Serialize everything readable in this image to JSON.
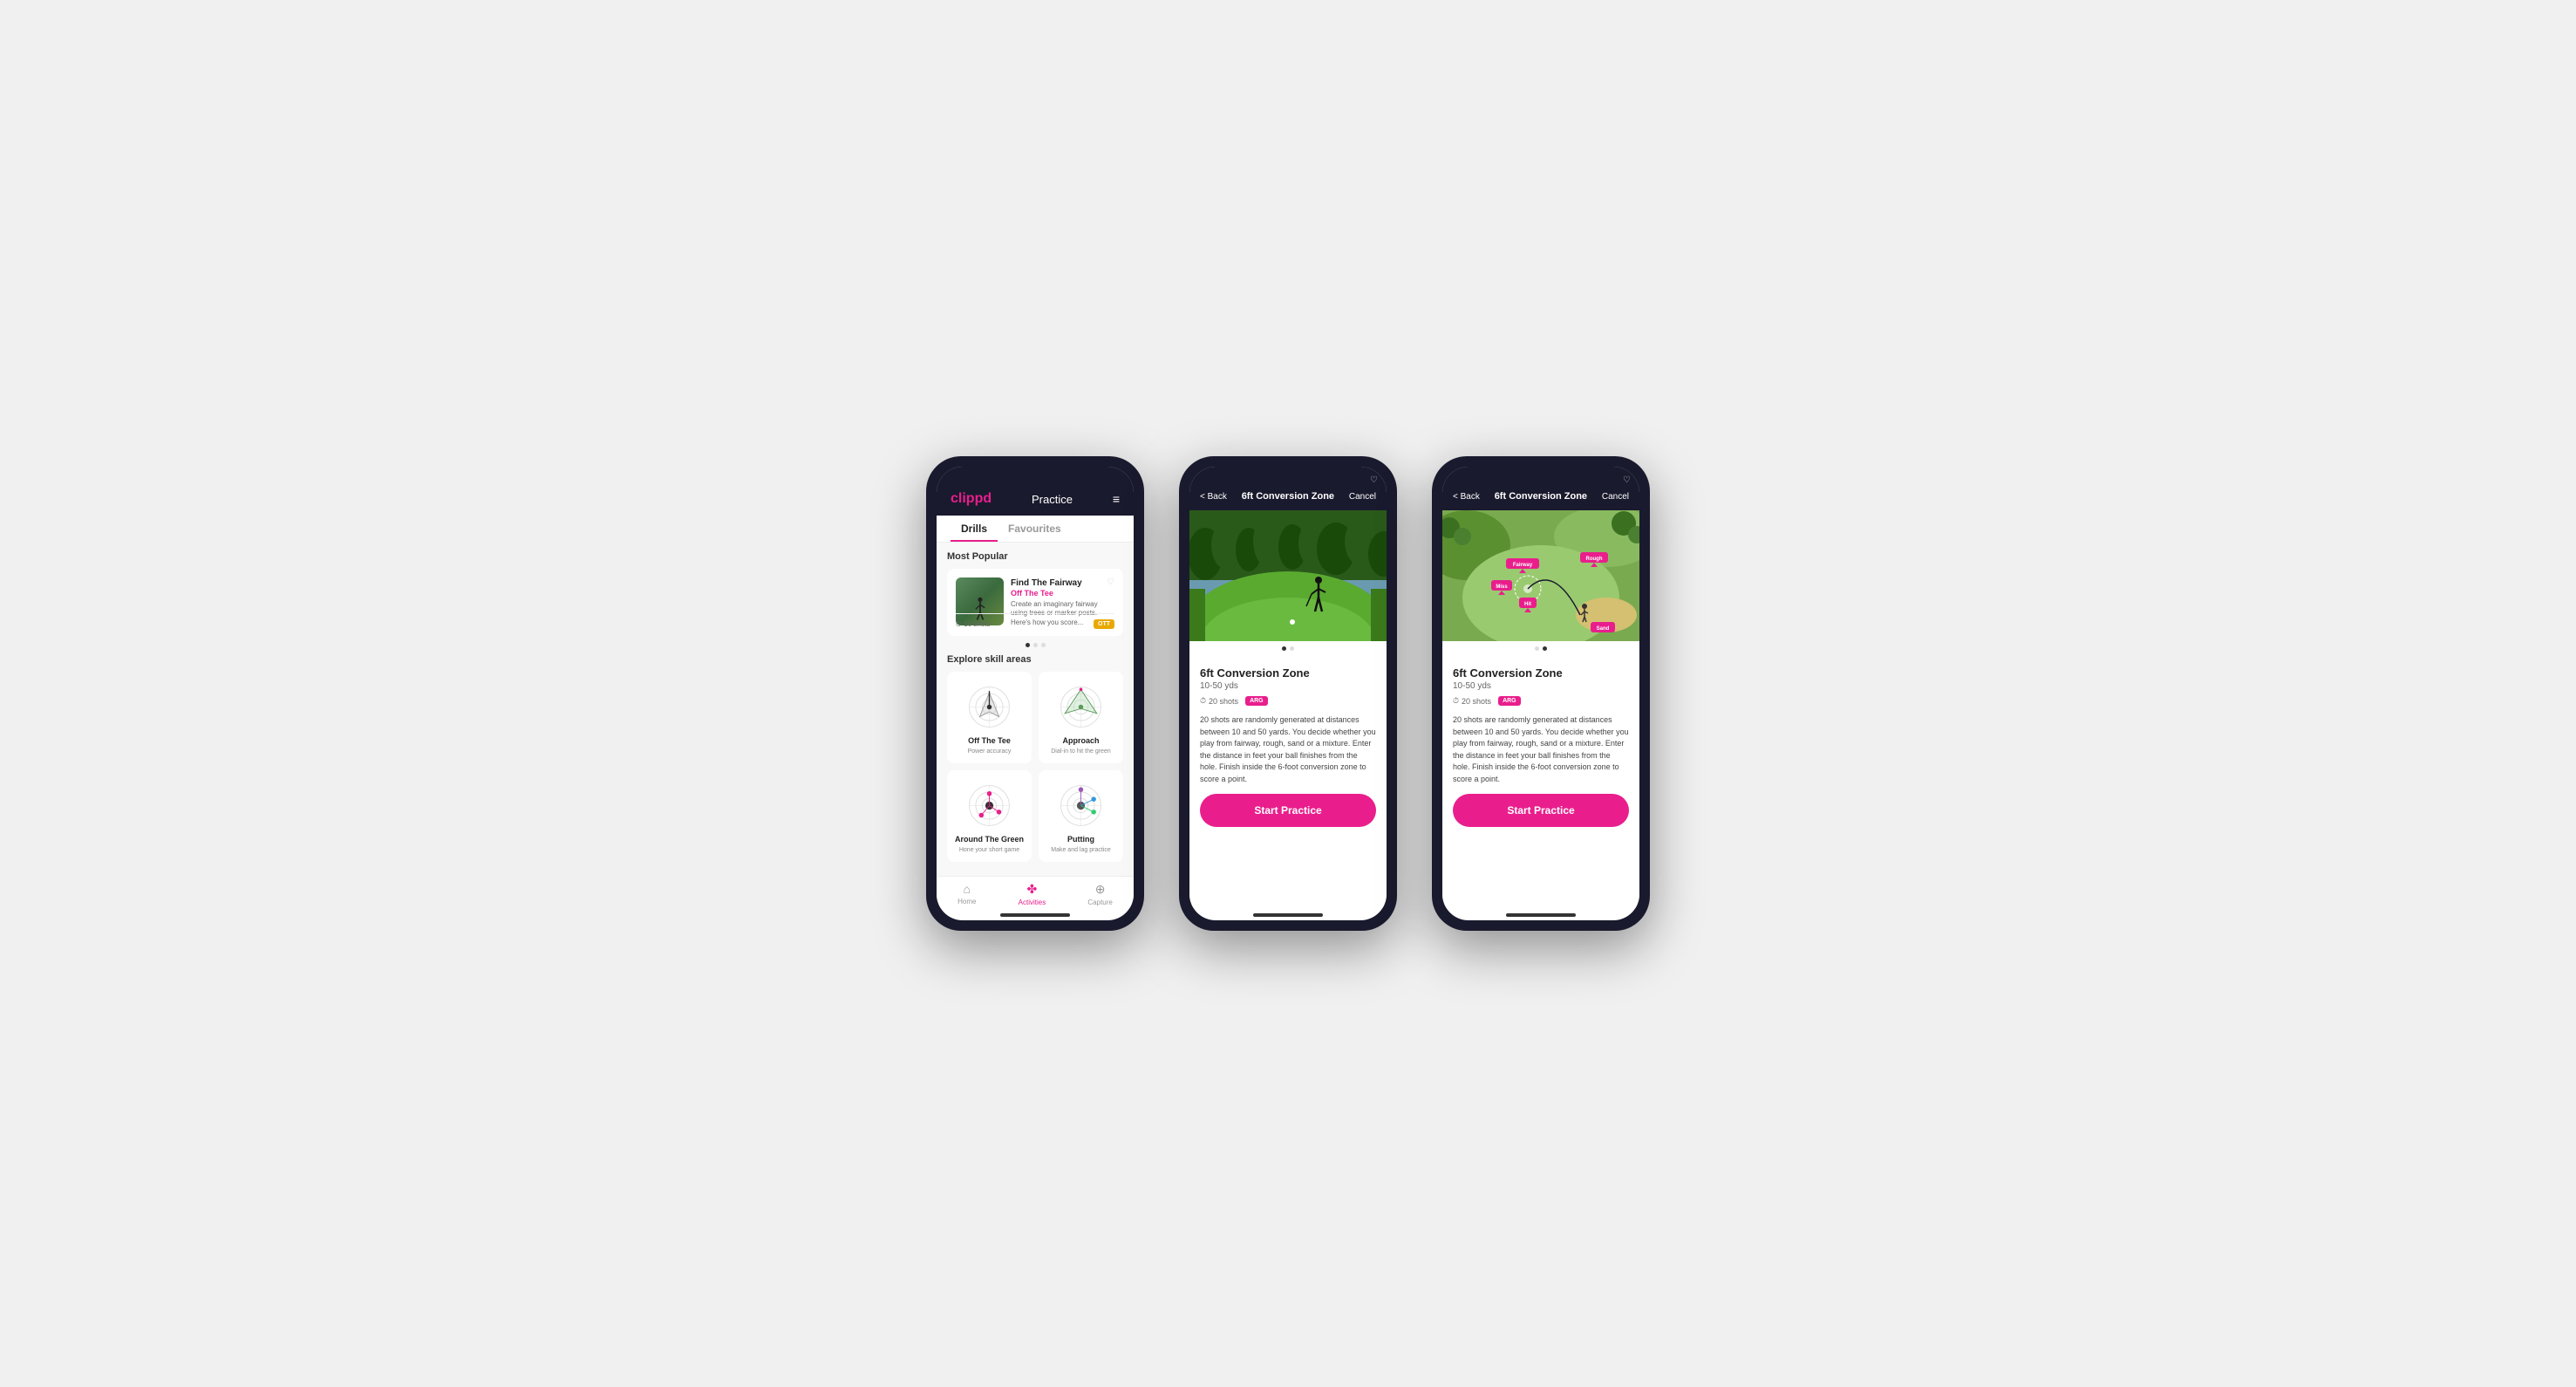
{
  "phones": [
    {
      "id": "phone1",
      "type": "practice-list",
      "header": {
        "logo": "clippd",
        "title": "Practice",
        "menu_icon": "≡"
      },
      "tabs": [
        {
          "label": "Drills",
          "active": true
        },
        {
          "label": "Favourites",
          "active": false
        }
      ],
      "most_popular_label": "Most Popular",
      "featured_drill": {
        "title": "Find The Fairway",
        "subtitle": "Off The Tee",
        "description": "Create an imaginary fairway using trees or marker posts. Here's how you score...",
        "shots": "10 shots",
        "tag": "OTT"
      },
      "explore_label": "Explore skill areas",
      "skill_areas": [
        {
          "name": "Off The Tee",
          "desc": "Power accuracy",
          "icon": "ott"
        },
        {
          "name": "Approach",
          "desc": "Dial-in to hit the green",
          "icon": "approach"
        },
        {
          "name": "Around The Green",
          "desc": "Hone your short game",
          "icon": "arg"
        },
        {
          "name": "Putting",
          "desc": "Make and lag practice",
          "icon": "putting"
        }
      ],
      "nav": [
        {
          "label": "Home",
          "icon": "⌂",
          "active": false
        },
        {
          "label": "Activities",
          "icon": "♣",
          "active": true
        },
        {
          "label": "Capture",
          "icon": "⊕",
          "active": false
        }
      ]
    },
    {
      "id": "phone2",
      "type": "drill-detail-photo",
      "header": {
        "back_label": "< Back",
        "title": "6ft Conversion Zone",
        "cancel_label": "Cancel"
      },
      "drill": {
        "title": "6ft Conversion Zone",
        "range": "10-50 yds",
        "shots": "20 shots",
        "tag": "ARG",
        "description": "20 shots are randomly generated at distances between 10 and 50 yards. You decide whether you play from fairway, rough, sand or a mixture. Enter the distance in feet your ball finishes from the hole. Finish inside the 6-foot conversion zone to score a point."
      },
      "start_button": "Start Practice"
    },
    {
      "id": "phone3",
      "type": "drill-detail-map",
      "header": {
        "back_label": "< Back",
        "title": "6ft Conversion Zone",
        "cancel_label": "Cancel"
      },
      "drill": {
        "title": "6ft Conversion Zone",
        "range": "10-50 yds",
        "shots": "20 shots",
        "tag": "ARG",
        "description": "20 shots are randomly generated at distances between 10 and 50 yards. You decide whether you play from fairway, rough, sand or a mixture. Enter the distance in feet your ball finishes from the hole. Finish inside the 6-foot conversion zone to score a point."
      },
      "map_labels": [
        "Fairway",
        "Rough",
        "Miss",
        "Hit",
        "Sand"
      ],
      "start_button": "Start Practice"
    }
  ]
}
